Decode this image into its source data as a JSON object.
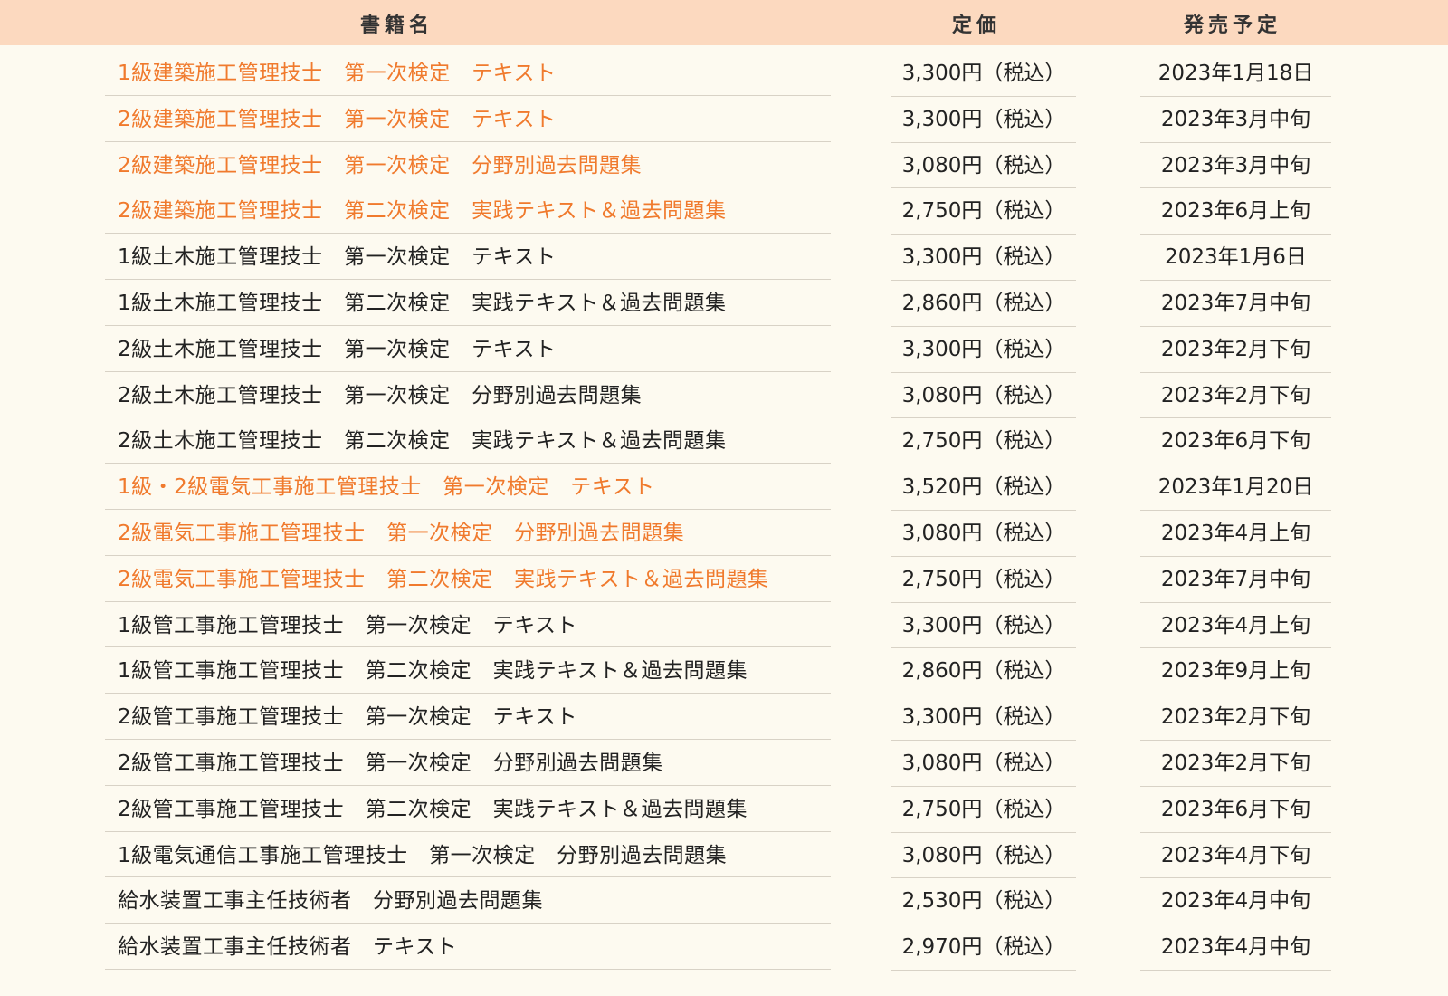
{
  "header": {
    "title": "書籍名",
    "price": "定価",
    "release": "発売予定"
  },
  "rows": [
    {
      "title": "1級建築施工管理技士　第一次検定　テキスト",
      "price": "3,300円（税込）",
      "release": "2023年1月18日",
      "highlight": true
    },
    {
      "title": "2級建築施工管理技士　第一次検定　テキスト",
      "price": "3,300円（税込）",
      "release": "2023年3月中旬",
      "highlight": true
    },
    {
      "title": "2級建築施工管理技士　第一次検定　分野別過去問題集",
      "price": "3,080円（税込）",
      "release": "2023年3月中旬",
      "highlight": true
    },
    {
      "title": "2級建築施工管理技士　第二次検定　実践テキスト＆過去問題集",
      "price": "2,750円（税込）",
      "release": "2023年6月上旬",
      "highlight": true
    },
    {
      "title": "1級土木施工管理技士　第一次検定　テキスト",
      "price": "3,300円（税込）",
      "release": "2023年1月6日",
      "highlight": false
    },
    {
      "title": "1級土木施工管理技士　第二次検定　実践テキスト＆過去問題集",
      "price": "2,860円（税込）",
      "release": "2023年7月中旬",
      "highlight": false
    },
    {
      "title": "2級土木施工管理技士　第一次検定　テキスト",
      "price": "3,300円（税込）",
      "release": "2023年2月下旬",
      "highlight": false
    },
    {
      "title": "2級土木施工管理技士　第一次検定　分野別過去問題集",
      "price": "3,080円（税込）",
      "release": "2023年2月下旬",
      "highlight": false
    },
    {
      "title": "2級土木施工管理技士　第二次検定　実践テキスト＆過去問題集",
      "price": "2,750円（税込）",
      "release": "2023年6月下旬",
      "highlight": false
    },
    {
      "title": "1級・2級電気工事施工管理技士　第一次検定　テキスト",
      "price": "3,520円（税込）",
      "release": "2023年1月20日",
      "highlight": true
    },
    {
      "title": "2級電気工事施工管理技士　第一次検定　分野別過去問題集",
      "price": "3,080円（税込）",
      "release": "2023年4月上旬",
      "highlight": true
    },
    {
      "title": "2級電気工事施工管理技士　第二次検定　実践テキスト＆過去問題集",
      "price": "2,750円（税込）",
      "release": "2023年7月中旬",
      "highlight": true
    },
    {
      "title": "1級管工事施工管理技士　第一次検定　テキスト",
      "price": "3,300円（税込）",
      "release": "2023年4月上旬",
      "highlight": false
    },
    {
      "title": "1級管工事施工管理技士　第二次検定　実践テキスト＆過去問題集",
      "price": "2,860円（税込）",
      "release": "2023年9月上旬",
      "highlight": false
    },
    {
      "title": "2級管工事施工管理技士　第一次検定　テキスト",
      "price": "3,300円（税込）",
      "release": "2023年2月下旬",
      "highlight": false
    },
    {
      "title": "2級管工事施工管理技士　第一次検定　分野別過去問題集",
      "price": "3,080円（税込）",
      "release": "2023年2月下旬",
      "highlight": false
    },
    {
      "title": "2級管工事施工管理技士　第二次検定　実践テキスト＆過去問題集",
      "price": "2,750円（税込）",
      "release": "2023年6月下旬",
      "highlight": false
    },
    {
      "title": "1級電気通信工事施工管理技士　第一次検定　分野別過去問題集",
      "price": "3,080円（税込）",
      "release": "2023年4月下旬",
      "highlight": false
    },
    {
      "title": "給水装置工事主任技術者　分野別過去問題集",
      "price": "2,530円（税込）",
      "release": "2023年4月中旬",
      "highlight": false
    },
    {
      "title": "給水装置工事主任技術者　テキスト",
      "price": "2,970円（税込）",
      "release": "2023年4月中旬",
      "highlight": false
    }
  ]
}
